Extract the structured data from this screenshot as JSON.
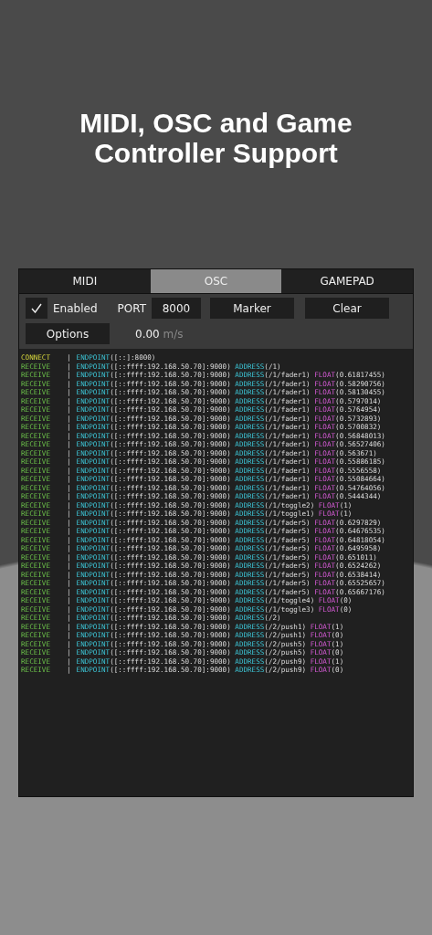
{
  "headline": "MIDI, OSC and Game Controller Support",
  "tabs": [
    {
      "label": "MIDI",
      "selected": false
    },
    {
      "label": "OSC",
      "selected": true
    },
    {
      "label": "GAMEPAD",
      "selected": false
    }
  ],
  "controls": {
    "enabled": {
      "label": "Enabled",
      "checked": true
    },
    "port": {
      "label": "PORT",
      "value": "8000"
    },
    "buttons": [
      "Marker",
      "Clear"
    ],
    "options": "Options",
    "speed": {
      "value": "0.00",
      "unit": "m/s"
    }
  },
  "log": [
    {
      "event": "CONNECT",
      "kind": "connect",
      "sep": "|",
      "fields": [
        {
          "kind": "endpoint",
          "key": "ENDPOINT",
          "value": "([::]:8000)"
        }
      ]
    },
    {
      "event": "RECEIVE",
      "kind": "receive",
      "sep": "|",
      "fields": [
        {
          "kind": "endpoint",
          "key": "ENDPOINT",
          "value": "([::ffff:192.168.50.70]:9000)"
        },
        {
          "kind": "address",
          "key": "ADDRESS",
          "value": "(/1)"
        }
      ]
    },
    {
      "event": "RECEIVE",
      "kind": "receive",
      "sep": "|",
      "fields": [
        {
          "kind": "endpoint",
          "key": "ENDPOINT",
          "value": "([::ffff:192.168.50.70]:9000)"
        },
        {
          "kind": "address",
          "key": "ADDRESS",
          "value": "(/1/fader1)"
        },
        {
          "kind": "float",
          "key": "FLOAT",
          "value": "(0.61817455)"
        }
      ]
    },
    {
      "event": "RECEIVE",
      "kind": "receive",
      "sep": "|",
      "fields": [
        {
          "kind": "endpoint",
          "key": "ENDPOINT",
          "value": "([::ffff:192.168.50.70]:9000)"
        },
        {
          "kind": "address",
          "key": "ADDRESS",
          "value": "(/1/fader1)"
        },
        {
          "kind": "float",
          "key": "FLOAT",
          "value": "(0.58290756)"
        }
      ]
    },
    {
      "event": "RECEIVE",
      "kind": "receive",
      "sep": "|",
      "fields": [
        {
          "kind": "endpoint",
          "key": "ENDPOINT",
          "value": "([::ffff:192.168.50.70]:9000)"
        },
        {
          "kind": "address",
          "key": "ADDRESS",
          "value": "(/1/fader1)"
        },
        {
          "kind": "float",
          "key": "FLOAT",
          "value": "(0.58130455)"
        }
      ]
    },
    {
      "event": "RECEIVE",
      "kind": "receive",
      "sep": "|",
      "fields": [
        {
          "kind": "endpoint",
          "key": "ENDPOINT",
          "value": "([::ffff:192.168.50.70]:9000)"
        },
        {
          "kind": "address",
          "key": "ADDRESS",
          "value": "(/1/fader1)"
        },
        {
          "kind": "float",
          "key": "FLOAT",
          "value": "(0.5797014)"
        }
      ]
    },
    {
      "event": "RECEIVE",
      "kind": "receive",
      "sep": "|",
      "fields": [
        {
          "kind": "endpoint",
          "key": "ENDPOINT",
          "value": "([::ffff:192.168.50.70]:9000)"
        },
        {
          "kind": "address",
          "key": "ADDRESS",
          "value": "(/1/fader1)"
        },
        {
          "kind": "float",
          "key": "FLOAT",
          "value": "(0.5764954)"
        }
      ]
    },
    {
      "event": "RECEIVE",
      "kind": "receive",
      "sep": "|",
      "fields": [
        {
          "kind": "endpoint",
          "key": "ENDPOINT",
          "value": "([::ffff:192.168.50.70]:9000)"
        },
        {
          "kind": "address",
          "key": "ADDRESS",
          "value": "(/1/fader1)"
        },
        {
          "kind": "float",
          "key": "FLOAT",
          "value": "(0.5732893)"
        }
      ]
    },
    {
      "event": "RECEIVE",
      "kind": "receive",
      "sep": "|",
      "fields": [
        {
          "kind": "endpoint",
          "key": "ENDPOINT",
          "value": "([::ffff:192.168.50.70]:9000)"
        },
        {
          "kind": "address",
          "key": "ADDRESS",
          "value": "(/1/fader1)"
        },
        {
          "kind": "float",
          "key": "FLOAT",
          "value": "(0.5700832)"
        }
      ]
    },
    {
      "event": "RECEIVE",
      "kind": "receive",
      "sep": "|",
      "fields": [
        {
          "kind": "endpoint",
          "key": "ENDPOINT",
          "value": "([::ffff:192.168.50.70]:9000)"
        },
        {
          "kind": "address",
          "key": "ADDRESS",
          "value": "(/1/fader1)"
        },
        {
          "kind": "float",
          "key": "FLOAT",
          "value": "(0.56848013)"
        }
      ]
    },
    {
      "event": "RECEIVE",
      "kind": "receive",
      "sep": "|",
      "fields": [
        {
          "kind": "endpoint",
          "key": "ENDPOINT",
          "value": "([::ffff:192.168.50.70]:9000)"
        },
        {
          "kind": "address",
          "key": "ADDRESS",
          "value": "(/1/fader1)"
        },
        {
          "kind": "float",
          "key": "FLOAT",
          "value": "(0.56527406)"
        }
      ]
    },
    {
      "event": "RECEIVE",
      "kind": "receive",
      "sep": "|",
      "fields": [
        {
          "kind": "endpoint",
          "key": "ENDPOINT",
          "value": "([::ffff:192.168.50.70]:9000)"
        },
        {
          "kind": "address",
          "key": "ADDRESS",
          "value": "(/1/fader1)"
        },
        {
          "kind": "float",
          "key": "FLOAT",
          "value": "(0.563671)"
        }
      ]
    },
    {
      "event": "RECEIVE",
      "kind": "receive",
      "sep": "|",
      "fields": [
        {
          "kind": "endpoint",
          "key": "ENDPOINT",
          "value": "([::ffff:192.168.50.70]:9000)"
        },
        {
          "kind": "address",
          "key": "ADDRESS",
          "value": "(/1/fader1)"
        },
        {
          "kind": "float",
          "key": "FLOAT",
          "value": "(0.55886185)"
        }
      ]
    },
    {
      "event": "RECEIVE",
      "kind": "receive",
      "sep": "|",
      "fields": [
        {
          "kind": "endpoint",
          "key": "ENDPOINT",
          "value": "([::ffff:192.168.50.70]:9000)"
        },
        {
          "kind": "address",
          "key": "ADDRESS",
          "value": "(/1/fader1)"
        },
        {
          "kind": "float",
          "key": "FLOAT",
          "value": "(0.5556558)"
        }
      ]
    },
    {
      "event": "RECEIVE",
      "kind": "receive",
      "sep": "|",
      "fields": [
        {
          "kind": "endpoint",
          "key": "ENDPOINT",
          "value": "([::ffff:192.168.50.70]:9000)"
        },
        {
          "kind": "address",
          "key": "ADDRESS",
          "value": "(/1/fader1)"
        },
        {
          "kind": "float",
          "key": "FLOAT",
          "value": "(0.55084664)"
        }
      ]
    },
    {
      "event": "RECEIVE",
      "kind": "receive",
      "sep": "|",
      "fields": [
        {
          "kind": "endpoint",
          "key": "ENDPOINT",
          "value": "([::ffff:192.168.50.70]:9000)"
        },
        {
          "kind": "address",
          "key": "ADDRESS",
          "value": "(/1/fader1)"
        },
        {
          "kind": "float",
          "key": "FLOAT",
          "value": "(0.54764056)"
        }
      ]
    },
    {
      "event": "RECEIVE",
      "kind": "receive",
      "sep": "|",
      "fields": [
        {
          "kind": "endpoint",
          "key": "ENDPOINT",
          "value": "([::ffff:192.168.50.70]:9000)"
        },
        {
          "kind": "address",
          "key": "ADDRESS",
          "value": "(/1/fader1)"
        },
        {
          "kind": "float",
          "key": "FLOAT",
          "value": "(0.5444344)"
        }
      ]
    },
    {
      "event": "RECEIVE",
      "kind": "receive",
      "sep": "|",
      "fields": [
        {
          "kind": "endpoint",
          "key": "ENDPOINT",
          "value": "([::ffff:192.168.50.70]:9000)"
        },
        {
          "kind": "address",
          "key": "ADDRESS",
          "value": "(/1/toggle2)"
        },
        {
          "kind": "float",
          "key": "FLOAT",
          "value": "(1)"
        }
      ]
    },
    {
      "event": "RECEIVE",
      "kind": "receive",
      "sep": "|",
      "fields": [
        {
          "kind": "endpoint",
          "key": "ENDPOINT",
          "value": "([::ffff:192.168.50.70]:9000)"
        },
        {
          "kind": "address",
          "key": "ADDRESS",
          "value": "(/1/toggle1)"
        },
        {
          "kind": "float",
          "key": "FLOAT",
          "value": "(1)"
        }
      ]
    },
    {
      "event": "RECEIVE",
      "kind": "receive",
      "sep": "|",
      "fields": [
        {
          "kind": "endpoint",
          "key": "ENDPOINT",
          "value": "([::ffff:192.168.50.70]:9000)"
        },
        {
          "kind": "address",
          "key": "ADDRESS",
          "value": "(/1/fader5)"
        },
        {
          "kind": "float",
          "key": "FLOAT",
          "value": "(0.6297829)"
        }
      ]
    },
    {
      "event": "RECEIVE",
      "kind": "receive",
      "sep": "|",
      "fields": [
        {
          "kind": "endpoint",
          "key": "ENDPOINT",
          "value": "([::ffff:192.168.50.70]:9000)"
        },
        {
          "kind": "address",
          "key": "ADDRESS",
          "value": "(/1/fader5)"
        },
        {
          "kind": "float",
          "key": "FLOAT",
          "value": "(0.64676535)"
        }
      ]
    },
    {
      "event": "RECEIVE",
      "kind": "receive",
      "sep": "|",
      "fields": [
        {
          "kind": "endpoint",
          "key": "ENDPOINT",
          "value": "([::ffff:192.168.50.70]:9000)"
        },
        {
          "kind": "address",
          "key": "ADDRESS",
          "value": "(/1/fader5)"
        },
        {
          "kind": "float",
          "key": "FLOAT",
          "value": "(0.64818054)"
        }
      ]
    },
    {
      "event": "RECEIVE",
      "kind": "receive",
      "sep": "|",
      "fields": [
        {
          "kind": "endpoint",
          "key": "ENDPOINT",
          "value": "([::ffff:192.168.50.70]:9000)"
        },
        {
          "kind": "address",
          "key": "ADDRESS",
          "value": "(/1/fader5)"
        },
        {
          "kind": "float",
          "key": "FLOAT",
          "value": "(0.6495958)"
        }
      ]
    },
    {
      "event": "RECEIVE",
      "kind": "receive",
      "sep": "|",
      "fields": [
        {
          "kind": "endpoint",
          "key": "ENDPOINT",
          "value": "([::ffff:192.168.50.70]:9000)"
        },
        {
          "kind": "address",
          "key": "ADDRESS",
          "value": "(/1/fader5)"
        },
        {
          "kind": "float",
          "key": "FLOAT",
          "value": "(0.651011)"
        }
      ]
    },
    {
      "event": "RECEIVE",
      "kind": "receive",
      "sep": "|",
      "fields": [
        {
          "kind": "endpoint",
          "key": "ENDPOINT",
          "value": "([::ffff:192.168.50.70]:9000)"
        },
        {
          "kind": "address",
          "key": "ADDRESS",
          "value": "(/1/fader5)"
        },
        {
          "kind": "float",
          "key": "FLOAT",
          "value": "(0.6524262)"
        }
      ]
    },
    {
      "event": "RECEIVE",
      "kind": "receive",
      "sep": "|",
      "fields": [
        {
          "kind": "endpoint",
          "key": "ENDPOINT",
          "value": "([::ffff:192.168.50.70]:9000)"
        },
        {
          "kind": "address",
          "key": "ADDRESS",
          "value": "(/1/fader5)"
        },
        {
          "kind": "float",
          "key": "FLOAT",
          "value": "(0.6538414)"
        }
      ]
    },
    {
      "event": "RECEIVE",
      "kind": "receive",
      "sep": "|",
      "fields": [
        {
          "kind": "endpoint",
          "key": "ENDPOINT",
          "value": "([::ffff:192.168.50.70]:9000)"
        },
        {
          "kind": "address",
          "key": "ADDRESS",
          "value": "(/1/fader5)"
        },
        {
          "kind": "float",
          "key": "FLOAT",
          "value": "(0.65525657)"
        }
      ]
    },
    {
      "event": "RECEIVE",
      "kind": "receive",
      "sep": "|",
      "fields": [
        {
          "kind": "endpoint",
          "key": "ENDPOINT",
          "value": "([::ffff:192.168.50.70]:9000)"
        },
        {
          "kind": "address",
          "key": "ADDRESS",
          "value": "(/1/fader5)"
        },
        {
          "kind": "float",
          "key": "FLOAT",
          "value": "(0.65667176)"
        }
      ]
    },
    {
      "event": "RECEIVE",
      "kind": "receive",
      "sep": "|",
      "fields": [
        {
          "kind": "endpoint",
          "key": "ENDPOINT",
          "value": "([::ffff:192.168.50.70]:9000)"
        },
        {
          "kind": "address",
          "key": "ADDRESS",
          "value": "(/1/toggle4)"
        },
        {
          "kind": "float",
          "key": "FLOAT",
          "value": "(0)"
        }
      ]
    },
    {
      "event": "RECEIVE",
      "kind": "receive",
      "sep": "|",
      "fields": [
        {
          "kind": "endpoint",
          "key": "ENDPOINT",
          "value": "([::ffff:192.168.50.70]:9000)"
        },
        {
          "kind": "address",
          "key": "ADDRESS",
          "value": "(/1/toggle3)"
        },
        {
          "kind": "float",
          "key": "FLOAT",
          "value": "(0)"
        }
      ]
    },
    {
      "event": "RECEIVE",
      "kind": "receive",
      "sep": "|",
      "fields": [
        {
          "kind": "endpoint",
          "key": "ENDPOINT",
          "value": "([::ffff:192.168.50.70]:9000)"
        },
        {
          "kind": "address",
          "key": "ADDRESS",
          "value": "(/2)"
        }
      ]
    },
    {
      "event": "RECEIVE",
      "kind": "receive",
      "sep": "|",
      "fields": [
        {
          "kind": "endpoint",
          "key": "ENDPOINT",
          "value": "([::ffff:192.168.50.70]:9000)"
        },
        {
          "kind": "address",
          "key": "ADDRESS",
          "value": "(/2/push1)"
        },
        {
          "kind": "float",
          "key": "FLOAT",
          "value": "(1)"
        }
      ]
    },
    {
      "event": "RECEIVE",
      "kind": "receive",
      "sep": "|",
      "fields": [
        {
          "kind": "endpoint",
          "key": "ENDPOINT",
          "value": "([::ffff:192.168.50.70]:9000)"
        },
        {
          "kind": "address",
          "key": "ADDRESS",
          "value": "(/2/push1)"
        },
        {
          "kind": "float",
          "key": "FLOAT",
          "value": "(0)"
        }
      ]
    },
    {
      "event": "RECEIVE",
      "kind": "receive",
      "sep": "|",
      "fields": [
        {
          "kind": "endpoint",
          "key": "ENDPOINT",
          "value": "([::ffff:192.168.50.70]:9000)"
        },
        {
          "kind": "address",
          "key": "ADDRESS",
          "value": "(/2/push5)"
        },
        {
          "kind": "float",
          "key": "FLOAT",
          "value": "(1)"
        }
      ]
    },
    {
      "event": "RECEIVE",
      "kind": "receive",
      "sep": "|",
      "fields": [
        {
          "kind": "endpoint",
          "key": "ENDPOINT",
          "value": "([::ffff:192.168.50.70]:9000)"
        },
        {
          "kind": "address",
          "key": "ADDRESS",
          "value": "(/2/push5)"
        },
        {
          "kind": "float",
          "key": "FLOAT",
          "value": "(0)"
        }
      ]
    },
    {
      "event": "RECEIVE",
      "kind": "receive",
      "sep": "|",
      "fields": [
        {
          "kind": "endpoint",
          "key": "ENDPOINT",
          "value": "([::ffff:192.168.50.70]:9000)"
        },
        {
          "kind": "address",
          "key": "ADDRESS",
          "value": "(/2/push9)"
        },
        {
          "kind": "float",
          "key": "FLOAT",
          "value": "(1)"
        }
      ]
    },
    {
      "event": "RECEIVE",
      "kind": "receive",
      "sep": "|",
      "fields": [
        {
          "kind": "endpoint",
          "key": "ENDPOINT",
          "value": "([::ffff:192.168.50.70]:9000)"
        },
        {
          "kind": "address",
          "key": "ADDRESS",
          "value": "(/2/push9)"
        },
        {
          "kind": "float",
          "key": "FLOAT",
          "value": "(0)"
        }
      ]
    }
  ]
}
